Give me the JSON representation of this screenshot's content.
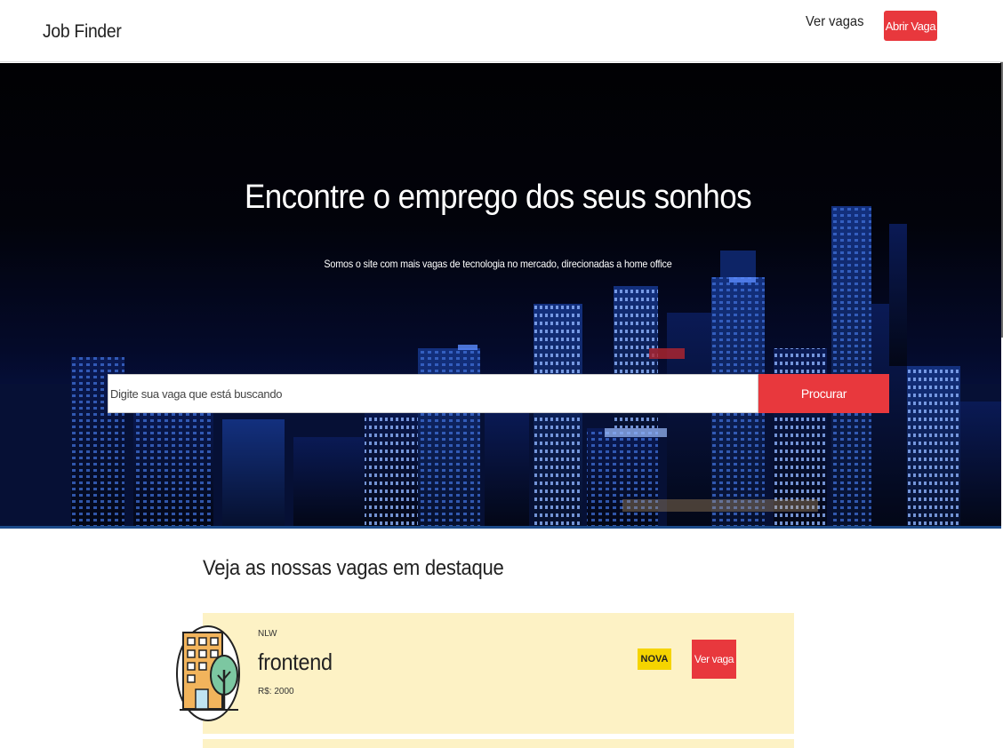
{
  "navbar": {
    "brand": "Job Finder",
    "link_label": "Ver vagas",
    "button_label": "Abrir Vaga"
  },
  "hero": {
    "title": "Encontre o emprego dos seus sonhos",
    "subtitle": "Somos o site com mais vagas de tecnologia no mercado, direcionadas a home office",
    "search_placeholder": "Digite sua vaga que está buscando",
    "search_button": "Procurar"
  },
  "featured": {
    "section_title": "Veja as nossas vagas em destaque",
    "jobs": [
      {
        "company": "NLW",
        "title": "frontend",
        "salary": "R$: 2000",
        "badge": "NOVA",
        "button_label": "Ver vaga",
        "logo_icon": "building-tree-icon"
      }
    ]
  },
  "colors": {
    "accent": "#e8383d",
    "badge": "#f5d400",
    "card_background": "#fdf2c5",
    "hero_background": "#02030b"
  }
}
